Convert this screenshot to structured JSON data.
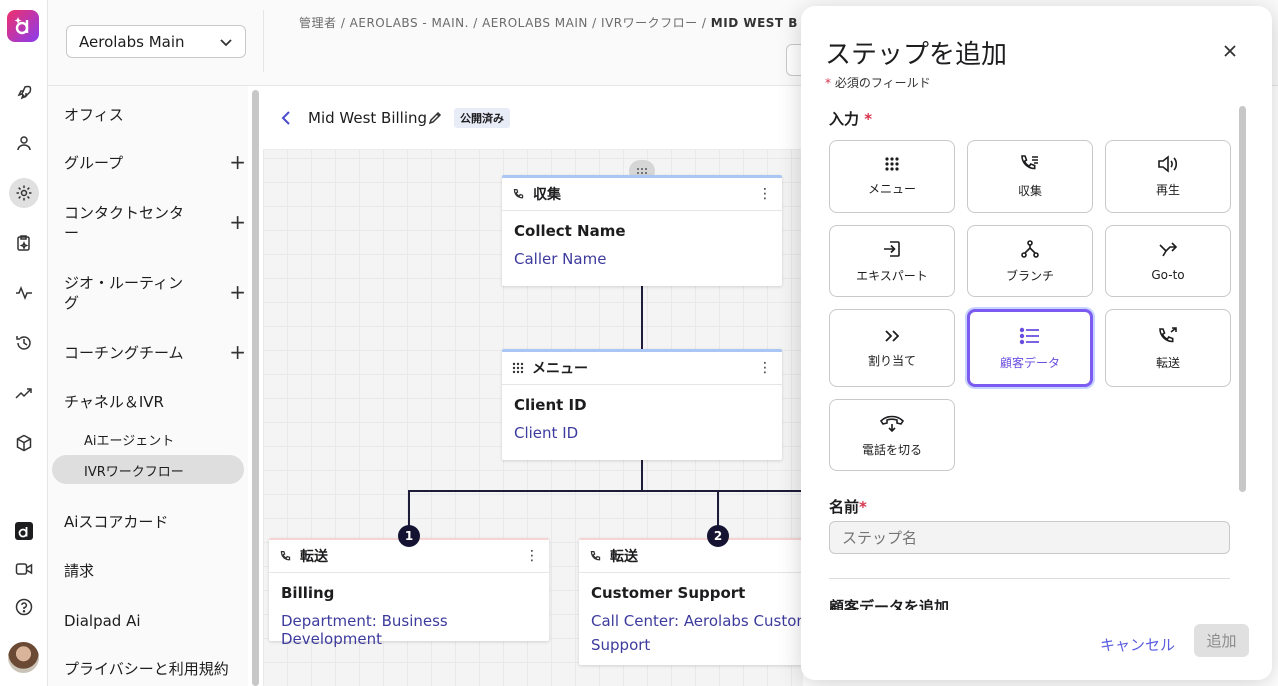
{
  "header": {
    "org_selector": "Aerolabs Main",
    "breadcrumb_prefix": "管理者 / AEROLABS - MAIN. / AEROLABS MAIN / IVRワークフロー / ",
    "breadcrumb_current": "MID WEST B"
  },
  "sidebar": {
    "items": [
      {
        "label": "オフィス"
      },
      {
        "label": "グループ"
      },
      {
        "label": "コンタクトセンター"
      },
      {
        "label": "ジオ・ルーティング"
      },
      {
        "label": "コーチングチーム"
      },
      {
        "label": "チャネル＆IVR"
      },
      {
        "label": "Aiスコアカード"
      },
      {
        "label": "請求"
      },
      {
        "label": "Dialpad Ai"
      },
      {
        "label": "プライバシーと利用規約"
      }
    ],
    "subitems": [
      {
        "label": "Aiエージェント"
      },
      {
        "label": "IVRワークフロー"
      }
    ],
    "plus": "+"
  },
  "workflow": {
    "title": "Mid West Billing",
    "status": "公開済み",
    "nodes": [
      {
        "type": "収集",
        "name": "Collect Name",
        "detail": "Caller Name"
      },
      {
        "type": "メニュー",
        "name": "Client ID",
        "detail": "Client ID"
      },
      {
        "type": "転送",
        "name": "Billing",
        "detail": "Department: Business Development",
        "branch": "1"
      },
      {
        "type": "転送",
        "name": "Customer Support",
        "detail": "Call Center: Aerolabs Customer",
        "detail2": "Support",
        "branch": "2"
      }
    ]
  },
  "modal": {
    "title": "ステップを追加",
    "required_note": "必須のフィールド",
    "input_label": "入力",
    "step_types": [
      {
        "label": "メニュー",
        "icon": "keypad-icon"
      },
      {
        "label": "収集",
        "icon": "phone-collect-icon"
      },
      {
        "label": "再生",
        "icon": "speaker-icon"
      },
      {
        "label": "エキスパート",
        "icon": "enter-icon"
      },
      {
        "label": "ブランチ",
        "icon": "branch-icon"
      },
      {
        "label": "Go-to",
        "icon": "goto-icon"
      },
      {
        "label": "割り当て",
        "icon": "double-chevron-icon"
      },
      {
        "label": "顧客データ",
        "icon": "list-icon",
        "selected": true
      },
      {
        "label": "転送",
        "icon": "phone-transfer-icon"
      },
      {
        "label": "電話を切る",
        "icon": "hangup-icon"
      }
    ],
    "name_label": "名前",
    "name_placeholder": "ステップ名",
    "section_label": "顧客データを追加",
    "cancel": "キャンセル",
    "add": "追加"
  },
  "colors": {
    "accent": "#7c5cf0",
    "link": "#3d3b9d",
    "node_blue": "#a9c6f5",
    "node_red": "#f6d4d4"
  }
}
